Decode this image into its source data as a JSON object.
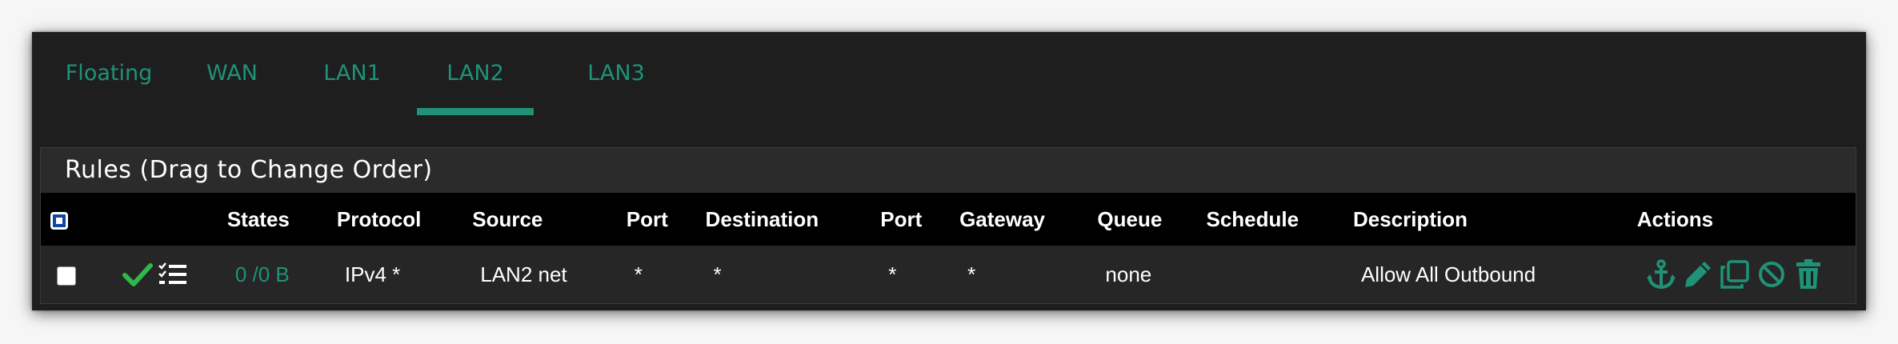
{
  "tabs": [
    {
      "label": "Floating"
    },
    {
      "label": "WAN"
    },
    {
      "label": "LAN1"
    },
    {
      "label": "LAN2",
      "active": true
    },
    {
      "label": "LAN3"
    }
  ],
  "panel": {
    "heading": "Rules (Drag to Change Order)"
  },
  "table": {
    "headers": {
      "states": "States",
      "protocol": "Protocol",
      "source": "Source",
      "port": "Port",
      "destination": "Destination",
      "port2": "Port",
      "gateway": "Gateway",
      "queue": "Queue",
      "schedule": "Schedule",
      "description": "Description",
      "actions": "Actions"
    },
    "rows": [
      {
        "states": "0 /0 B",
        "protocol": "IPv4 *",
        "source": "LAN2 net",
        "port": "*",
        "destination": "*",
        "port2": "*",
        "gateway": "*",
        "queue": "none",
        "schedule": "",
        "description": "Allow All Outbound"
      }
    ]
  },
  "icons": {
    "status": [
      "check-icon",
      "list-icon"
    ],
    "actions": [
      "anchor-icon",
      "pencil-icon",
      "copy-icon",
      "disable-icon",
      "trash-icon"
    ]
  },
  "colors": {
    "accent": "#1f9277",
    "check": "#2fb84a",
    "background": "#1e1e1e",
    "header_row": "#000000"
  }
}
